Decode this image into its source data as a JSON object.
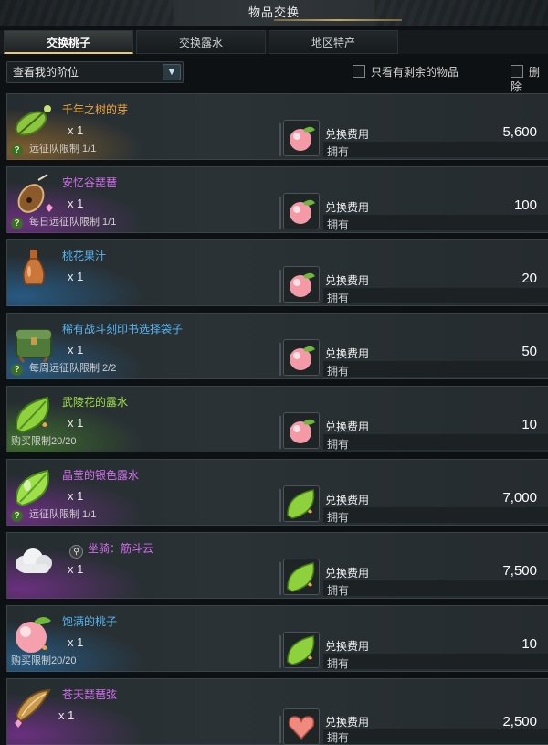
{
  "window": {
    "title": "物品交换"
  },
  "tabs": [
    {
      "label": "交换桃子",
      "active": true
    },
    {
      "label": "交换露水",
      "active": false
    },
    {
      "label": "地区特产",
      "active": false
    }
  ],
  "filters": {
    "grade_dropdown": "查看我的阶位",
    "only_remaining": "只看有剩余的物品",
    "delete_cut": "删除"
  },
  "labels": {
    "cost": "兑换费用",
    "owned": "拥有"
  },
  "items": [
    {
      "name": "千年之树的芽",
      "quantity": "x 1",
      "limit": "远征队限制 1/1",
      "limit_has_help": true,
      "price": "5,600",
      "rarity": "orange",
      "icon": "sprout-leaf-icon",
      "cost_icon": "peach-icon"
    },
    {
      "name": "安忆谷琵琶",
      "quantity": "x 1",
      "limit": "每日远征队限制 1/1",
      "limit_has_help": true,
      "price": "100",
      "rarity": "purple",
      "icon": "lute-icon",
      "cost_icon": "peach-icon"
    },
    {
      "name": "桃花果汁",
      "quantity": "x 1",
      "limit": "",
      "limit_has_help": false,
      "price": "20",
      "rarity": "blue",
      "icon": "vase-icon",
      "cost_icon": "peach-icon"
    },
    {
      "name": "稀有战斗刻印书选择袋子",
      "quantity": "x 1",
      "limit": "每周远征队限制 2/2",
      "limit_has_help": true,
      "price": "50",
      "rarity": "blue",
      "icon": "bag-icon",
      "cost_icon": "peach-icon"
    },
    {
      "name": "武陵花的露水",
      "quantity": "x 1",
      "limit": "购买限制20/20",
      "limit_has_help": false,
      "price": "10",
      "rarity": "green",
      "icon": "green-dew-icon",
      "cost_icon": "peach-icon"
    },
    {
      "name": "晶莹的银色露水",
      "quantity": "x 1",
      "limit": "远征队限制 1/1",
      "limit_has_help": true,
      "price": "7,000",
      "rarity": "purple",
      "icon": "silver-dew-icon",
      "cost_icon": "green-dew-icon"
    },
    {
      "name": "坐骑：筋斗云",
      "quantity": "x 1",
      "limit": "",
      "limit_has_help": false,
      "price": "7,500",
      "rarity": "purple",
      "icon": "cloud-icon",
      "cost_icon": "green-dew-icon",
      "has_preview": true
    },
    {
      "name": "饱满的桃子",
      "quantity": "x 1",
      "limit": "购买限制20/20",
      "limit_has_help": false,
      "price": "10",
      "rarity": "blue",
      "icon": "peach-icon",
      "cost_icon": "green-dew-icon"
    },
    {
      "name": "苍天琵琶弦",
      "quantity": "x 1",
      "limit": "",
      "limit_has_help": false,
      "price": "2,500",
      "rarity": "purple",
      "icon": "strings-icon",
      "cost_icon": "heart-gem-icon"
    }
  ],
  "colors": {
    "orange": "#f4a53a",
    "purple": "#d56cf0",
    "blue": "#55b6f2",
    "green": "#9be042",
    "accent": "#e7c97a"
  }
}
